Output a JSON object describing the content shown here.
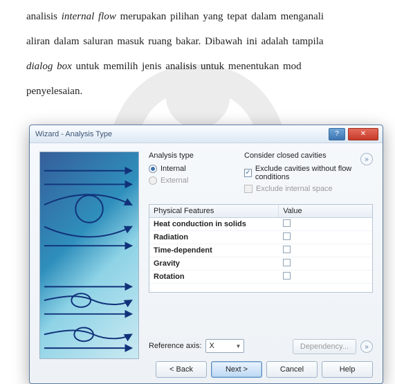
{
  "doc": {
    "line1a": "analisis ",
    "line1b": "internal flow",
    "line1c": " merupakan pilihan yang tepat dalam menganali",
    "line2": "aliran dalam saluran masuk ruang bakar. Dibawah ini adalah tampila",
    "line3a": "dialog box",
    "line3b": " untuk memilih jenis analisis untuk menentukan mod",
    "line4": "penyelesaian."
  },
  "dialog": {
    "title": "Wizard - Analysis Type",
    "help_icon": "?",
    "close_icon": "✕",
    "analysis_type": {
      "heading": "Analysis type",
      "internal": "Internal",
      "external": "External"
    },
    "cavities": {
      "heading": "Consider closed cavities",
      "exclude_flow": "Exclude cavities without flow conditions",
      "exclude_internal": "Exclude internal space"
    },
    "features": {
      "col_feature": "Physical Features",
      "col_value": "Value",
      "rows": [
        "Heat conduction in solids",
        "Radiation",
        "Time-dependent",
        "Gravity",
        "Rotation"
      ]
    },
    "reference_axis_label": "Reference axis:",
    "reference_axis_value": "X",
    "dependency": "Dependency...",
    "buttons": {
      "back": "< Back",
      "next": "Next >",
      "cancel": "Cancel",
      "help": "Help"
    },
    "expand_glyph": "»"
  }
}
